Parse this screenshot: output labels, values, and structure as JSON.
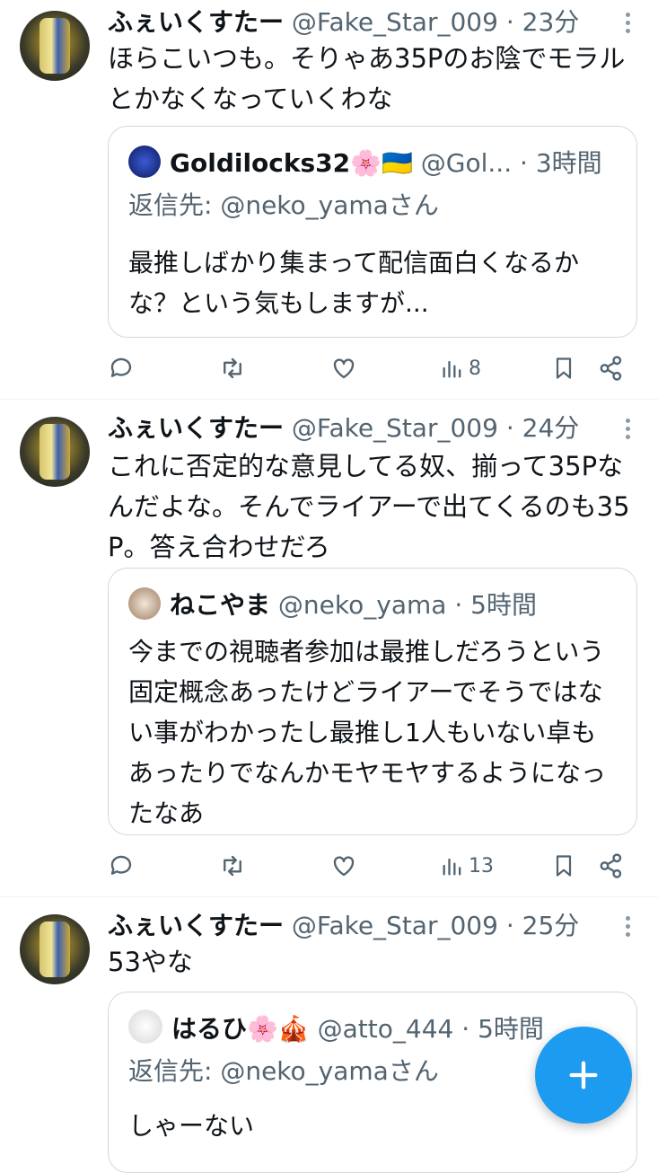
{
  "colors": {
    "accent": "#1d9bf0",
    "text": "#0f1419",
    "muted": "#536471",
    "border": "#cfd9de"
  },
  "tweets": [
    {
      "name": "ふぇいくすたー",
      "handle": "@Fake_Star_009",
      "time": "23分",
      "text": "ほらこいつも。そりゃあ35Pのお陰でモラルとかなくなっていくわな",
      "quote": {
        "name": "Goldilocks32🌸🇺🇦",
        "handle": "@Gol...",
        "time": "3時間",
        "reply_to": "返信先: @neko_yamaさん",
        "text": "最推しばかり集まって配信面白くなるかな？という気もしますが..."
      },
      "views": "8"
    },
    {
      "name": "ふぇいくすたー",
      "handle": "@Fake_Star_009",
      "time": "24分",
      "text": "これに否定的な意見してる奴、揃って35Pなんだよな。そんでライアーで出てくるのも35P。答え合わせだろ",
      "quote": {
        "name": "ねこやま",
        "handle": "@neko_yama",
        "time": "5時間",
        "text": "今までの視聴者参加は最推しだろうという固定概念あったけどライアーでそうではない事がわかったし最推し1人もいない卓もあったりでなんかモヤモヤするようになったなあ"
      },
      "views": "13"
    },
    {
      "name": "ふぇいくすたー",
      "handle": "@Fake_Star_009",
      "time": "25分",
      "text": "53やな",
      "quote": {
        "name": "はるひ🌸🎪",
        "handle": "@atto_444",
        "time": "5時間",
        "reply_to": "返信先: @neko_yamaさん",
        "text": "しゃーない"
      }
    }
  ],
  "icons": {
    "reply": "reply-icon",
    "retweet": "retweet-icon",
    "like": "like-icon",
    "views": "views-icon",
    "bookmark": "bookmark-icon",
    "share": "share-icon",
    "compose": "plus-icon"
  },
  "dot": "·"
}
